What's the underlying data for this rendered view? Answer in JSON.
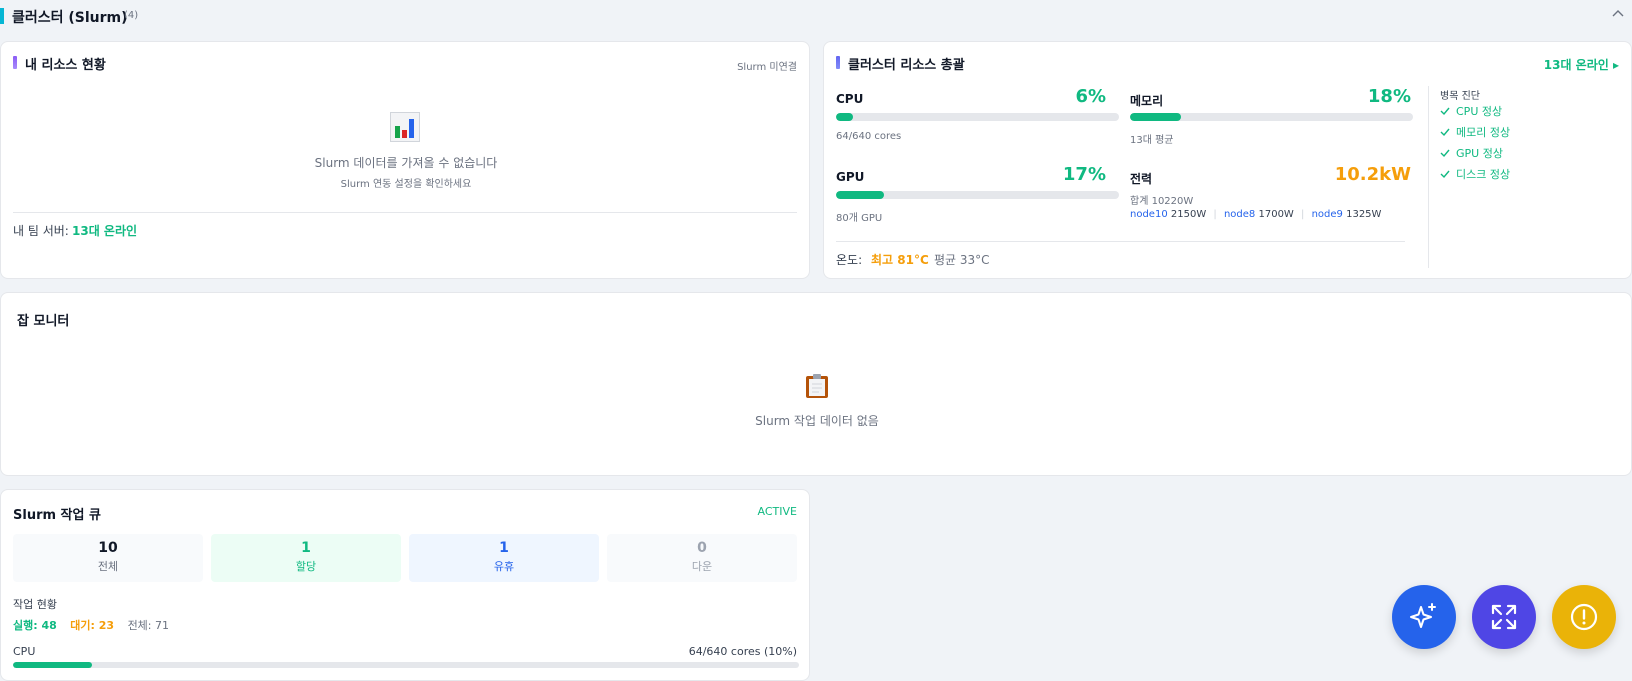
{
  "section": {
    "title": "클러스터 (Slurm)",
    "count": "(4)"
  },
  "my_resources": {
    "title": "내 리소스 현황",
    "status": "Slurm 미연결",
    "empty_icon": "bar-chart-icon",
    "empty_message": "Slurm 데이터를 가져올 수 없습니다",
    "empty_sub": "Slurm 연동 설정을 확인하세요",
    "team_label": "내 팀 서버:",
    "team_value": "13대 온라인"
  },
  "cluster_summary": {
    "title": "클러스터 리소스 총괄",
    "online_link": "13대 온라인",
    "cpu": {
      "label": "CPU",
      "value": "6%",
      "percent": 6,
      "sub": "64/640 cores"
    },
    "memory": {
      "label": "메모리",
      "value": "18%",
      "percent": 18,
      "sub": "13대 평균"
    },
    "gpu": {
      "label": "GPU",
      "value": "17%",
      "percent": 17,
      "sub": "80개 GPU"
    },
    "power": {
      "label": "전력",
      "value": "10.2kW",
      "sub": "합계 10220W",
      "nodes": [
        {
          "name": "node10",
          "watts": "2150W"
        },
        {
          "name": "node8",
          "watts": "1700W"
        },
        {
          "name": "node9",
          "watts": "1325W"
        }
      ]
    },
    "temperature": {
      "label": "온도:",
      "max": "최고 81°C",
      "avg": "평균 33°C"
    },
    "bottleneck": {
      "title": "병목 진단",
      "items": [
        "CPU 정상",
        "메모리 정상",
        "GPU 정상",
        "디스크 정상"
      ]
    },
    "colors": {
      "good": "#10b981",
      "warn": "#f59e0b"
    }
  },
  "job_monitor": {
    "title": "잡 모니터",
    "empty_icon": "clipboard-icon",
    "empty_message": "Slurm 작업 데이터 없음"
  },
  "job_queue": {
    "title": "Slurm 작업 큐",
    "badge": "ACTIVE",
    "stats": [
      {
        "num": "10",
        "label": "전체"
      },
      {
        "num": "1",
        "label": "할당"
      },
      {
        "num": "1",
        "label": "유휴"
      },
      {
        "num": "0",
        "label": "다운"
      }
    ],
    "work_title": "작업 현황",
    "running": "실행: 48",
    "waiting": "대기: 23",
    "total": "전체: 71",
    "cpu_label": "CPU",
    "cpu_value": "64/640 cores (10%)",
    "cpu_percent": 10
  },
  "fabs": [
    "sparkles-icon",
    "expand-icon",
    "alert-icon"
  ]
}
